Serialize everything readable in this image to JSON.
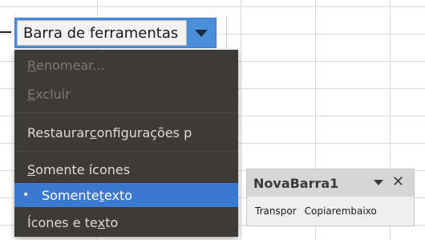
{
  "toolbar_dropdown": {
    "label": "Barra de ferramentas",
    "arrow_icon": "chevron-down-icon"
  },
  "context_menu": {
    "rename": {
      "underline": "R",
      "rest": "enomear..."
    },
    "delete": {
      "underline": "E",
      "rest": "xcluir"
    },
    "restore": {
      "pre": "Restaurar ",
      "underline": "c",
      "post": "onfigurações p"
    },
    "icons_only": {
      "underline": "S",
      "rest": "omente ícones"
    },
    "text_only": {
      "pre": "Somente ",
      "underline": "t",
      "post": "exto",
      "selected_marker": "•"
    },
    "icons_and_text": {
      "pre": "Ícones e te",
      "underline": "x",
      "post": "to"
    }
  },
  "floating_toolbar": {
    "title": "NovaBarra1",
    "menu_icon": "triangle-down-icon",
    "close_icon": "close-icon",
    "close_glyph": "✕",
    "buttons": [
      "Transpor",
      "Copiarembaixo"
    ]
  },
  "colors": {
    "menu_bg": "#3c3b37",
    "menu_selected": "#3b78cf",
    "dropdown_accent": "#4a90d9"
  }
}
